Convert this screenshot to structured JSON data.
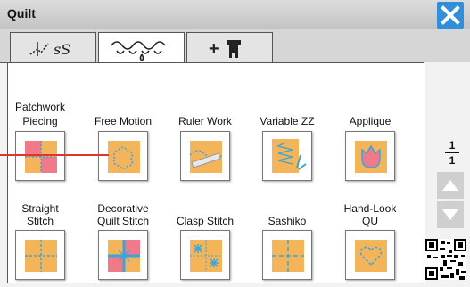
{
  "window": {
    "title": "Quilt"
  },
  "tabs": [
    {
      "name": "stitch-text-tab",
      "active": false
    },
    {
      "name": "decorative-tab",
      "active": true
    },
    {
      "name": "add-presser-foot-tab",
      "active": false,
      "label": "+"
    }
  ],
  "items": [
    {
      "label": "Patchwork\nPiecing",
      "icon": "patchwork-icon"
    },
    {
      "label": "Free Motion",
      "icon": "free-motion-icon"
    },
    {
      "label": "Ruler Work",
      "icon": "ruler-work-icon"
    },
    {
      "label": "Variable ZZ",
      "icon": "variable-zz-icon"
    },
    {
      "label": "Applique",
      "icon": "applique-icon"
    },
    {
      "label": "Straight\nStitch",
      "icon": "straight-stitch-icon"
    },
    {
      "label": "Decorative\nQuilt Stitch",
      "icon": "decorative-quilt-stitch-icon"
    },
    {
      "label": "Clasp Stitch",
      "icon": "clasp-stitch-icon"
    },
    {
      "label": "Sashiko",
      "icon": "sashiko-icon"
    },
    {
      "label": "Hand-Look\nQU",
      "icon": "hand-look-icon"
    }
  ],
  "pagination": {
    "current": "1",
    "total": "1"
  },
  "colors": {
    "accent": "#2f8fd8",
    "fabric_orange": "#f4b45a",
    "fabric_pink": "#f07a8a",
    "stitch_blue": "#3aa6d8"
  }
}
